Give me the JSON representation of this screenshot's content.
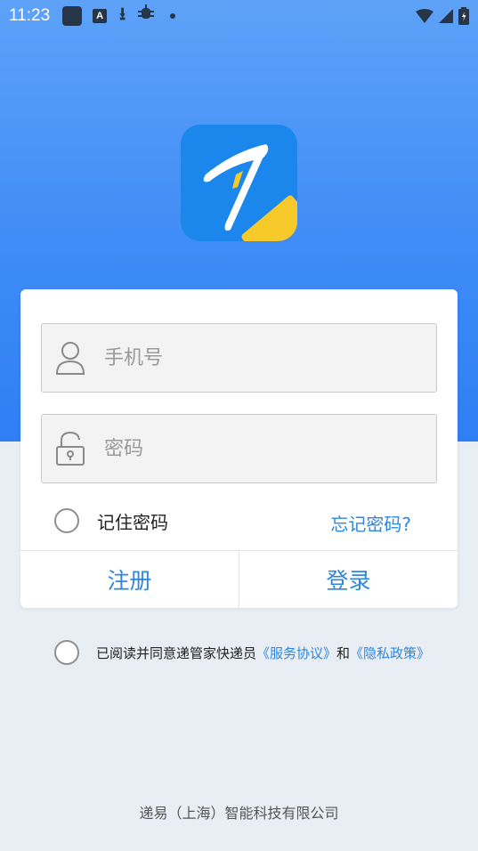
{
  "status_bar": {
    "time": "11:23",
    "a_icon_text": "A"
  },
  "login": {
    "phone_placeholder": "手机号",
    "password_placeholder": "密码",
    "remember_label": "记住密码",
    "forgot_label": "忘记密码?",
    "register_label": "注册",
    "login_label": "登录"
  },
  "agreement": {
    "prefix": "已阅读并同意递管家快递员",
    "service_link": "《服务协议》",
    "and": "和",
    "privacy_link": "《隐私政策》"
  },
  "footer": {
    "company": "递易（上海）智能科技有限公司"
  },
  "colors": {
    "accent": "#2e86de",
    "hero": "#3f8cf6",
    "logo_bg": "#1b86ec",
    "logo_ribbon": "#f7c92a"
  }
}
